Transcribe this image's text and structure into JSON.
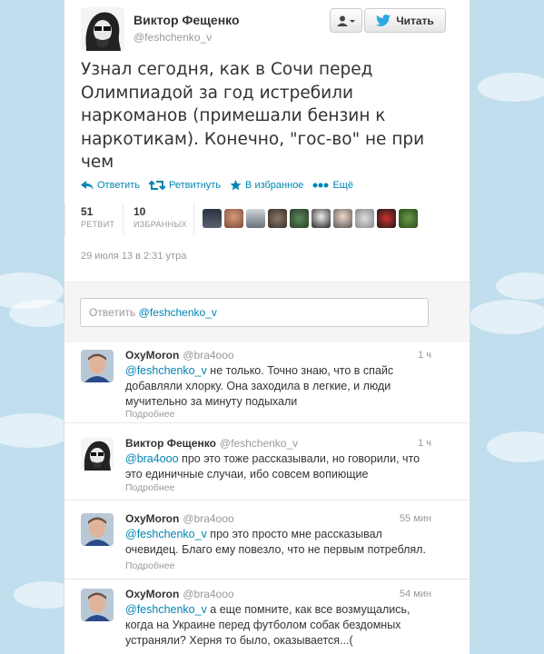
{
  "tweet": {
    "author_name": "Виктор Фещенко",
    "author_handle": "@feshchenko_v",
    "text": "Узнал сегодня, как в Сочи перед Олимпиадой за год истребили наркоманов (примешали бензин к наркотикам). Конечно, \"гос-во\" не при чем",
    "date": "29 июля 13 в 2:31 утра",
    "retweets": "51",
    "retweets_label": "РЕТВИТ",
    "favorites": "10",
    "favorites_label": "ИЗБРАННЫХ"
  },
  "header_buttons": {
    "follow_label": "Читать"
  },
  "actions": {
    "reply": "Ответить",
    "retweet": "Ретвитнуть",
    "favorite": "В избранное",
    "more": "Ещё"
  },
  "reply_box": {
    "placeholder_prefix": "Ответить",
    "mention": "@feshchenko_v"
  },
  "favoriters": [
    "avatar-1",
    "avatar-2",
    "avatar-3",
    "avatar-4",
    "avatar-5",
    "avatar-6",
    "avatar-7",
    "avatar-8",
    "avatar-9",
    "avatar-10"
  ],
  "replies": [
    {
      "name": "OxyMoron",
      "handle": "@bra4ooo",
      "time": "1 ч",
      "mention": "@feshchenko_v",
      "text": " не только. Точно знаю, что в спайс добавляли хлорку. Она заходила в легкие, и люди мучительно за минуту подыхали",
      "more": "Подробнее"
    },
    {
      "name": "Виктор Фещенко",
      "handle": "@feshchenko_v",
      "time": "1 ч",
      "mention": "@bra4ooo",
      "text": " про это тоже рассказывали, но говорили, что это единичные случаи, ибо совсем вопиющие",
      "more": "Подробнее"
    },
    {
      "name": "OxyMoron",
      "handle": "@bra4ooo",
      "time": "55 мин",
      "mention": "@feshchenko_v",
      "text": " про это просто мне рассказывал очевидец. Благо ему повезло, что не первым потреблял.",
      "more": "Подробнее"
    },
    {
      "name": "OxyMoron",
      "handle": "@bra4ooo",
      "time": "54 мин",
      "mention": "@feshchenko_v",
      "text": " а еще помните, как все возмущались, когда на Украине перед футболом собак бездомных устраняли? Херня то было, оказывается...(",
      "more": ""
    }
  ],
  "colors": {
    "link": "#0084b4",
    "background": "#c0deed"
  }
}
